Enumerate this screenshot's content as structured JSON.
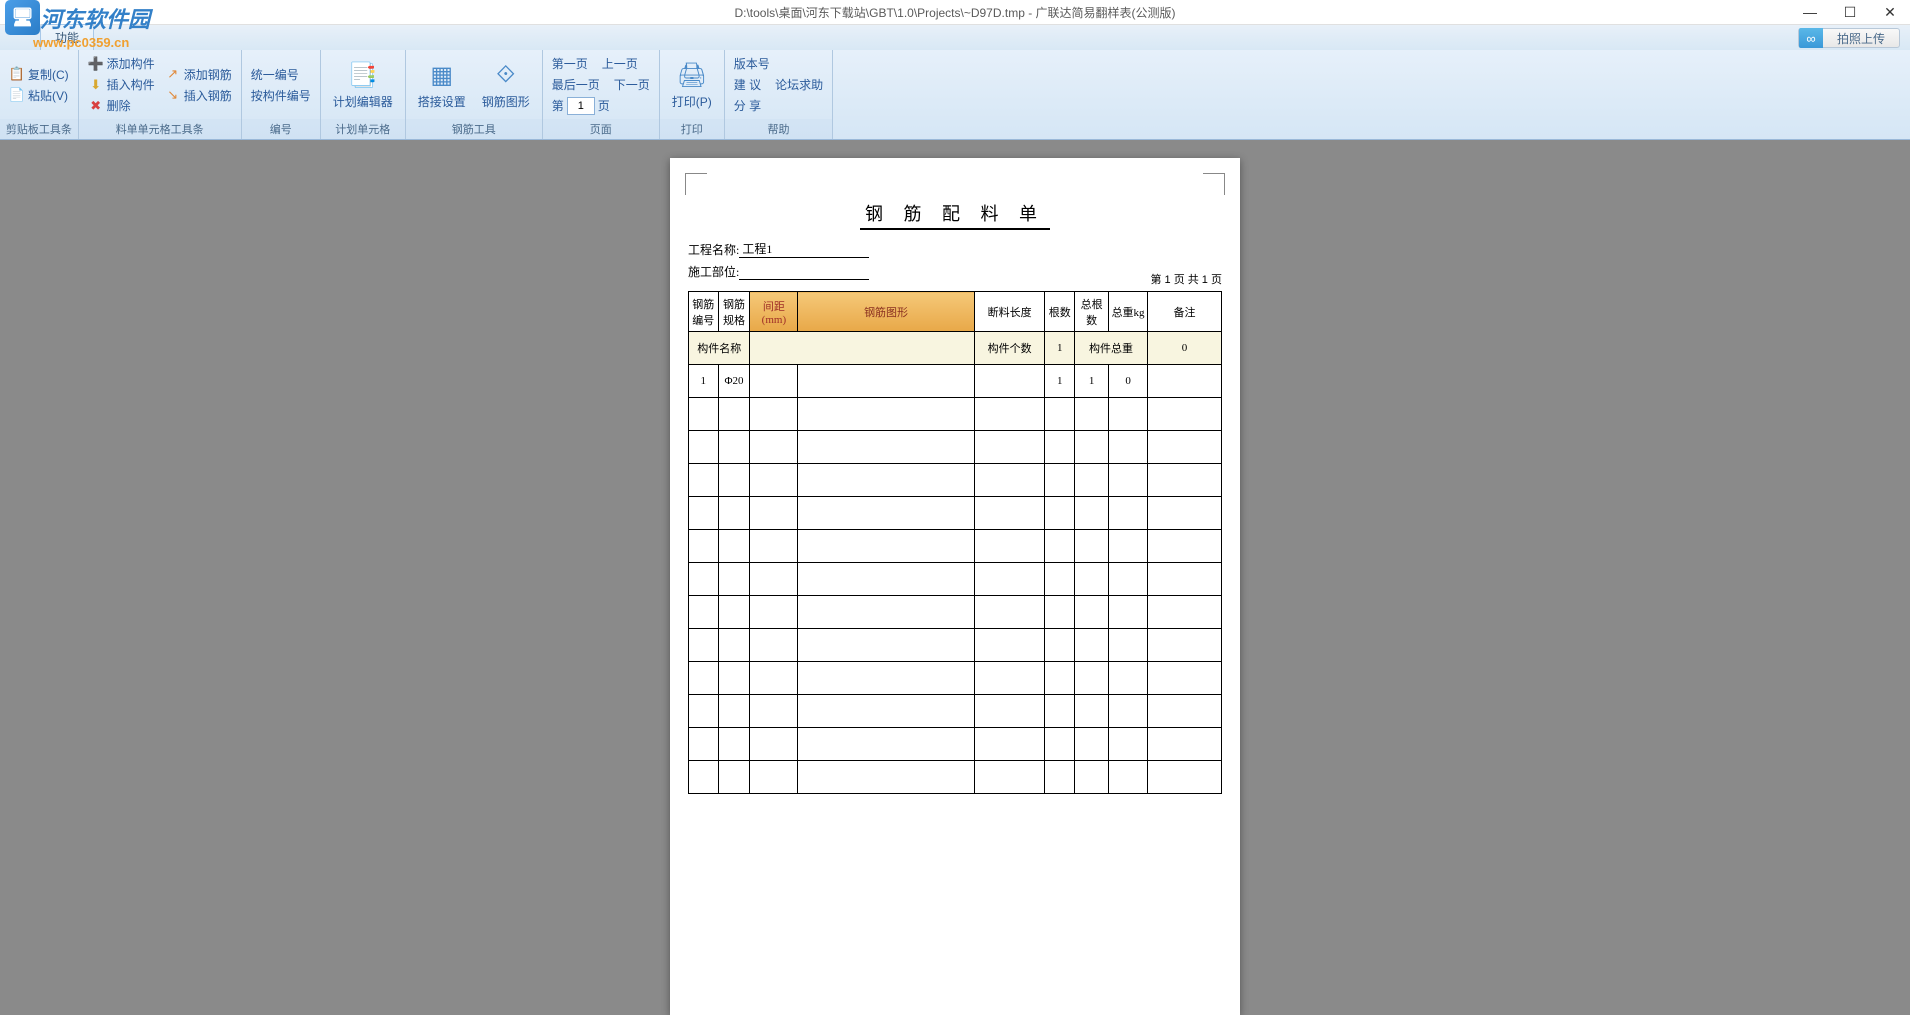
{
  "window": {
    "title": "D:\\tools\\桌面\\河东下载站\\GBT\\1.0\\Projects\\~D97D.tmp - 广联达简易翻样表(公测版)"
  },
  "watermark": {
    "site_name": "河东软件园",
    "url": "www.pc0359.cn"
  },
  "ribbon": {
    "tab_label": "功能",
    "upload_btn": "拍照上传",
    "groups": {
      "clipboard": {
        "label": "剪贴板工具条",
        "copy": "复制(C)",
        "paste": "粘贴(V)"
      },
      "cell_tools": {
        "label": "料单单元格工具条",
        "add_component": "添加构件",
        "insert_component": "插入构件",
        "delete": "删除",
        "add_rebar": "添加钢筋",
        "insert_rebar": "插入钢筋"
      },
      "numbering": {
        "label": "编号",
        "unified": "统一编号",
        "by_component": "按构件编号"
      },
      "plan_cell": {
        "label": "计划单元格",
        "editor": "计划编辑器"
      },
      "rebar_tools": {
        "label": "钢筋工具",
        "splice": "搭接设置",
        "shape": "钢筋图形"
      },
      "pagination": {
        "label": "页面",
        "first": "第一页",
        "prev": "上一页",
        "last": "最后一页",
        "next": "下一页",
        "page_prefix": "第",
        "page_value": "1",
        "page_suffix": "页"
      },
      "print": {
        "label": "打印",
        "print": "打印(P)"
      },
      "help": {
        "label": "帮助",
        "version": "版本号",
        "suggest": "建 议",
        "forum": "论坛求助",
        "share": "分 享"
      }
    }
  },
  "document": {
    "title": "钢 筋 配 料 单",
    "project_label": "工程名称:",
    "project_value": "工程1",
    "location_label": "施工部位:",
    "location_value": "",
    "page_info": "第 1 页 共 1 页",
    "headers": {
      "num": "钢筋编号",
      "spec": "钢筋规格",
      "gap": "间距(mm)",
      "shape": "钢筋图形",
      "cut_len": "断料长度",
      "qty": "根数",
      "total_qty": "总根数",
      "total_weight": "总重kg",
      "note": "备注"
    },
    "summary_row": {
      "component_name": "构件名称",
      "component_count_label": "构件个数",
      "component_count": "1",
      "component_weight_label": "构件总重",
      "component_weight": "0"
    },
    "data_row": {
      "num": "1",
      "spec": "Φ20",
      "qty": "1",
      "total_qty": "1",
      "weight": "0"
    }
  }
}
